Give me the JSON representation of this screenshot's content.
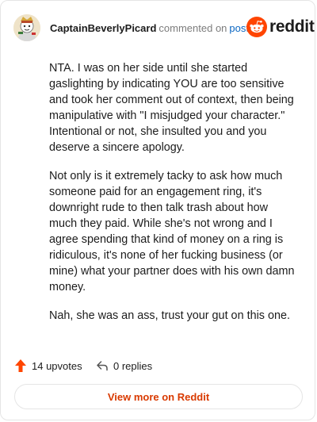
{
  "header": {
    "username": "CaptainBeverlyPicard",
    "action": "commented on",
    "post_link": "post",
    "brand": "reddit",
    "brand_color": "#ff4500"
  },
  "comment": {
    "paragraphs": [
      "NTA. I was on her side until she started gaslighting by indicating YOU are too sensitive and took her comment out of context, then being manipulative with \"I misjudged your character.\" Intentional or not, she insulted you and you deserve a sincere apology.",
      "Not only is it extremely tacky to ask how much someone paid for an engagement ring, it's downright rude to then talk trash about how much they paid. While she's not wrong and I agree spending that kind of money on a ring is ridiculous, it's none of her fucking business (or mine) what your partner does with his own damn money.",
      "Nah, she was an ass, trust your gut on this one."
    ]
  },
  "footer": {
    "upvotes_label": "14 upvotes",
    "replies_label": "0 replies",
    "upvote_icon": "upvote-arrow-icon",
    "reply_icon": "reply-arrow-icon",
    "upvote_color": "#ff4500"
  },
  "cta": {
    "label": "View more on Reddit",
    "color": "#d93a00"
  }
}
